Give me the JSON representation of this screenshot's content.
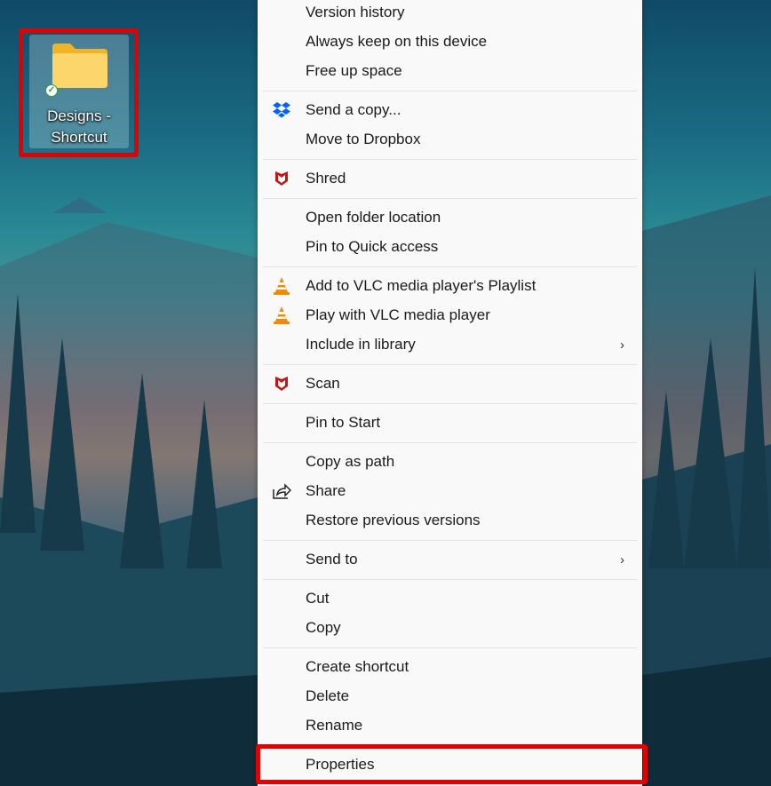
{
  "desktop_icon": {
    "label": "Designs - Shortcut",
    "label_line1": "Designs -",
    "label_line2": "Shortcut",
    "status": "synced-check-icon"
  },
  "highlight_color": "#e00000",
  "menu": {
    "groups": [
      [
        {
          "label": "Version history"
        },
        {
          "label": "Always keep on this device"
        },
        {
          "label": "Free up space"
        }
      ],
      [
        {
          "label": "Send a copy...",
          "icon": "dropbox-icon"
        },
        {
          "label": "Move to Dropbox"
        }
      ],
      [
        {
          "label": "Shred",
          "icon": "mcafee-icon"
        }
      ],
      [
        {
          "label": "Open folder location"
        },
        {
          "label": "Pin to Quick access"
        }
      ],
      [
        {
          "label": "Add to VLC media player's Playlist",
          "icon": "vlc-icon"
        },
        {
          "label": "Play with VLC media player",
          "icon": "vlc-icon"
        },
        {
          "label": "Include in library",
          "submenu": true
        }
      ],
      [
        {
          "label": "Scan",
          "icon": "mcafee-icon"
        }
      ],
      [
        {
          "label": "Pin to Start"
        }
      ],
      [
        {
          "label": "Copy as path"
        },
        {
          "label": "Share",
          "icon": "share-icon"
        },
        {
          "label": "Restore previous versions"
        }
      ],
      [
        {
          "label": "Send to",
          "submenu": true
        }
      ],
      [
        {
          "label": "Cut"
        },
        {
          "label": "Copy"
        }
      ],
      [
        {
          "label": "Create shortcut"
        },
        {
          "label": "Delete"
        },
        {
          "label": "Rename"
        }
      ],
      [
        {
          "label": "Properties",
          "highlighted": true
        }
      ]
    ]
  }
}
